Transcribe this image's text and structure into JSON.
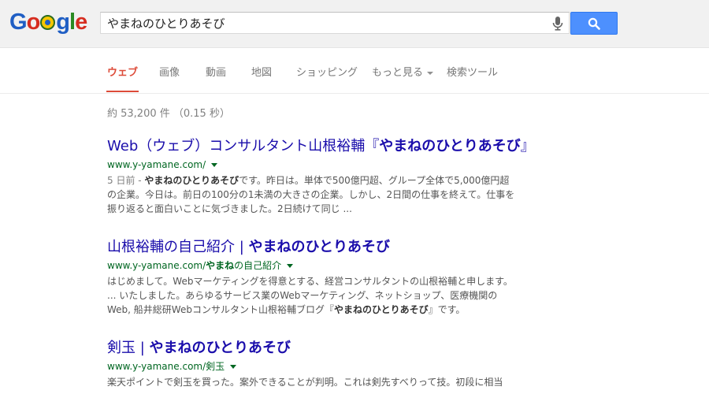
{
  "logo": {
    "text": "Google"
  },
  "search": {
    "query": "やまねのひとりあそび"
  },
  "tabs": [
    {
      "label": "ウェブ",
      "active": true
    },
    {
      "label": "画像"
    },
    {
      "label": "動画"
    },
    {
      "label": "地図"
    },
    {
      "label": "ショッピング"
    },
    {
      "label": "もっと見る"
    },
    {
      "label": "検索ツール"
    }
  ],
  "stats": "約 53,200 件 （0.15 秒）",
  "results": [
    {
      "title_pre": "Web（ウェブ）コンサルタント山根裕輔『",
      "title_bold": "やまねのひとりあそび",
      "title_post": "』",
      "url_pre": "www.y-yamane.com/",
      "url_bold": "",
      "url_post": "",
      "date": "5 日前 - ",
      "snippet_bold": "やまねのひとりあそび",
      "snippet_rest": "です。昨日は。単体で500億円超、グループ全体で5,000億円超の企業。今日は。前日の100分の1未満の大きさの企業。しかし、2日間の仕事を終えて。仕事を振り返ると面白いことに気づきました。2日続けて同じ ..."
    },
    {
      "title_pre": "山根裕輔の自己紹介 | ",
      "title_bold": "やまねのひとりあそび",
      "title_post": "",
      "url_pre": "www.y-yamane.com/",
      "url_bold": "やまね",
      "url_post": "の自己紹介",
      "snippet_a": "はじめまして。Webマーケティングを得意とする、経営コンサルタントの山根裕輔と申します。 ... いたしました。あらゆるサービス業のWebマーケティング、ネットショップ、医療機関のWeb, 船井総研Webコンサルタント山根裕輔ブログ『",
      "snippet_bold": "やまねのひとりあそび",
      "snippet_b": "』です。"
    },
    {
      "title_pre": "剣玉 | ",
      "title_bold": "やまねのひとりあそび",
      "title_post": "",
      "url_pre": "www.y-yamane.com/剣玉",
      "url_bold": "",
      "url_post": "",
      "snippet": "楽天ポイントで剣玉を買った。案外できることが判明。これは剣先すべりって技。初段に相当"
    }
  ]
}
